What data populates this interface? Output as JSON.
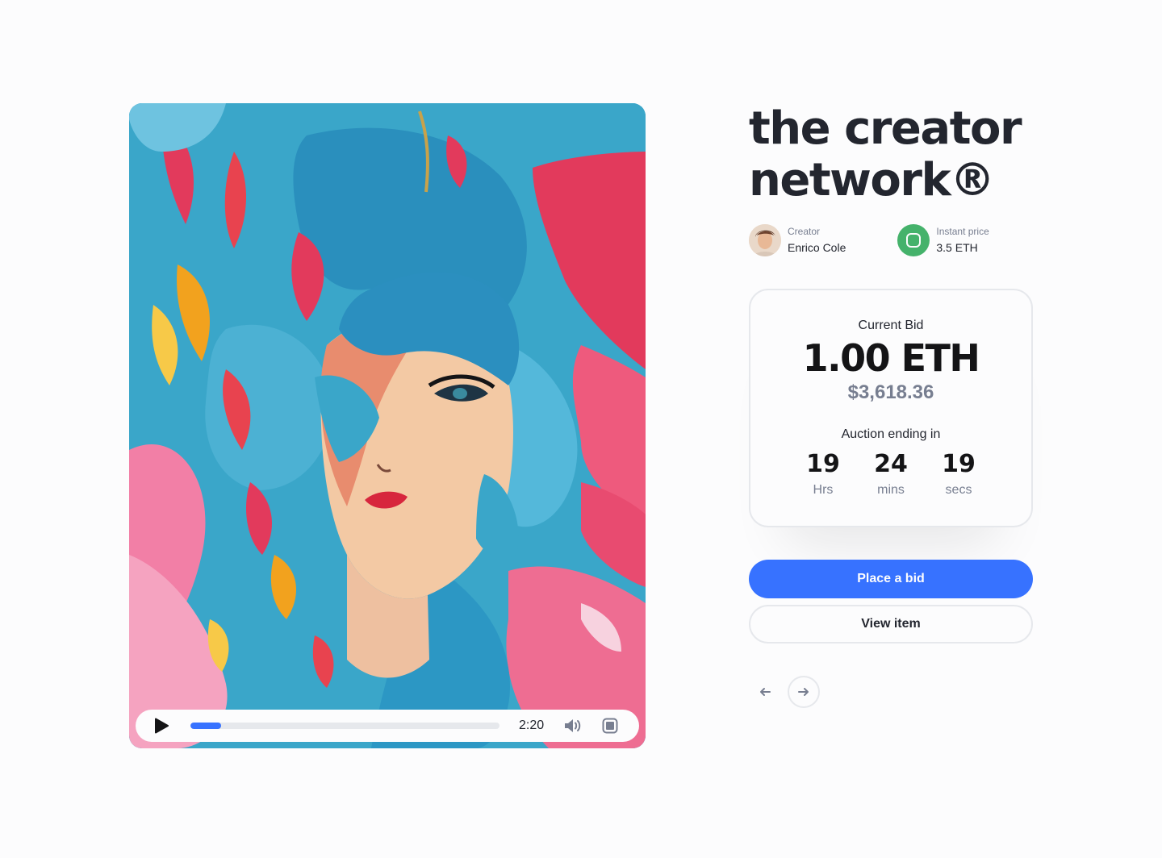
{
  "artwork": {
    "player": {
      "time": "2:20",
      "progress": 0.1,
      "icons": {
        "play": "play-icon",
        "volume": "volume-icon",
        "fullscreen": "fullscreen-icon"
      }
    }
  },
  "item": {
    "title": "the creator network®",
    "creator": {
      "label": "Creator",
      "name": "Enrico Cole"
    },
    "instant_price": {
      "label": "Instant price",
      "value": "3.5 ETH"
    }
  },
  "bid": {
    "label": "Current Bid",
    "eth": "1.00 ETH",
    "usd": "$3,618.36",
    "auction_label": "Auction ending in",
    "countdown": [
      {
        "value": "19",
        "unit": "Hrs"
      },
      {
        "value": "24",
        "unit": "mins"
      },
      {
        "value": "19",
        "unit": "secs"
      }
    ]
  },
  "actions": {
    "place_bid": "Place a bid",
    "view_item": "View item"
  },
  "nav": {
    "prev_icon": "arrow-left-icon",
    "next_icon": "arrow-right-icon"
  },
  "colors": {
    "accent": "#3772ff",
    "price_badge": "#45b26b",
    "text": "#23262f",
    "muted": "#777e90",
    "border": "#e6e8ec"
  }
}
